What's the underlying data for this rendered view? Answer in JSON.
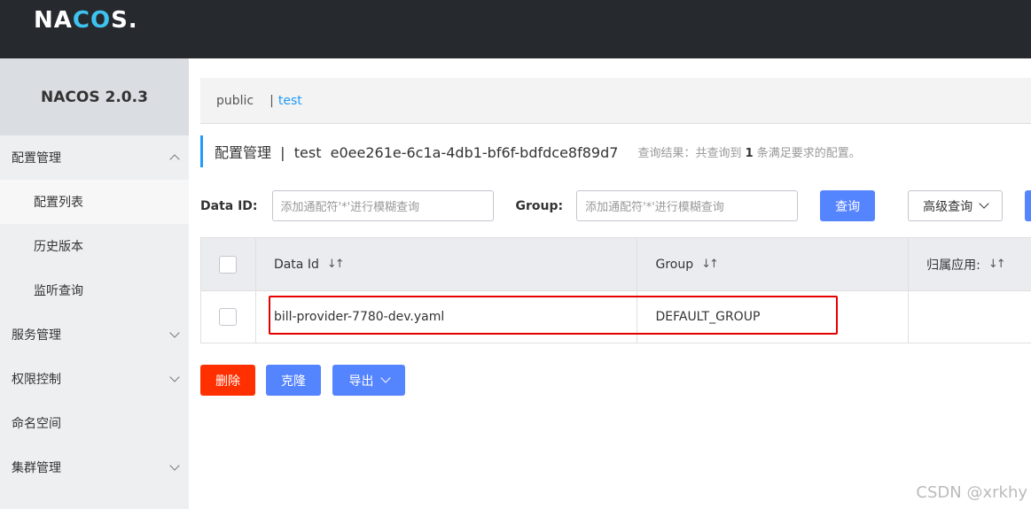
{
  "header": {
    "logo_pre": "NA",
    "logo_co": "CO",
    "logo_post": "S."
  },
  "sidebar": {
    "title": "NACOS 2.0.3",
    "items": [
      {
        "label": "配置管理",
        "icon": "chevron-up-icon"
      },
      {
        "label": "配置列表"
      },
      {
        "label": "历史版本"
      },
      {
        "label": "监听查询"
      },
      {
        "label": "服务管理",
        "icon": "chevron-down-icon"
      },
      {
        "label": "权限控制",
        "icon": "chevron-down-icon"
      },
      {
        "label": "命名空间"
      },
      {
        "label": "集群管理",
        "icon": "chevron-down-icon"
      }
    ]
  },
  "namespaces": {
    "public": "public",
    "separator": "|",
    "test": "test"
  },
  "page": {
    "title": "配置管理  |  test  e0ee261e-6c1a-4db1-bf6f-bdfdce8f89d7",
    "hint_prefix": "查询结果：共查询到 ",
    "hint_count": "1",
    "hint_suffix": " 条满足要求的配置。"
  },
  "search": {
    "data_id_label": "Data ID:",
    "data_id_placeholder": "添加通配符'*'进行模糊查询",
    "group_label": "Group:",
    "group_placeholder": "添加通配符'*'进行模糊查询",
    "query_button": "查询",
    "advanced_button": "高级查询"
  },
  "table": {
    "columns": [
      "Data Id",
      "Group",
      "归属应用:"
    ],
    "sort_glyph": "↓↑",
    "rows": [
      {
        "data_id": "bill-provider-7780-dev.yaml",
        "group": "DEFAULT_GROUP",
        "app": ""
      }
    ]
  },
  "actions": {
    "delete": "删除",
    "clone": "克隆",
    "export": "导出"
  },
  "watermark": "CSDN @xrkhy",
  "colors": {
    "primary": "#5584ff",
    "danger": "#ff3000",
    "topbar": "#262a2e",
    "highlight": "#e50000"
  }
}
